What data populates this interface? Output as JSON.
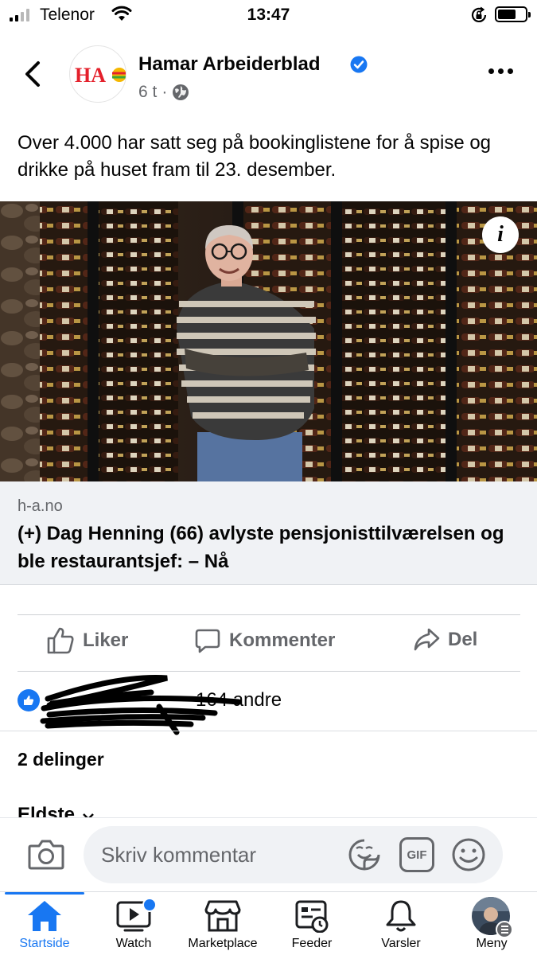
{
  "status_bar": {
    "carrier": "Telenor",
    "time": "13:47"
  },
  "post": {
    "page_name": "Hamar Arbeiderblad",
    "logo_text": "HA",
    "time_ago": "6 t",
    "separator": "·",
    "text": "Over 4.000 har satt seg på bookinglistene for å spise og drikke på huset fram til 23. desember.",
    "info_glyph": "i"
  },
  "link": {
    "domain": "h-a.no",
    "title": "(+) Dag Henning (66) avlyste pensjonisttilværelsen og ble restaurantsjef: – Nå"
  },
  "actions": {
    "like": "Liker",
    "comment": "Kommenter",
    "share": "Del"
  },
  "reactions": {
    "visible_text": "164 andre"
  },
  "shares": "2 delinger",
  "comments": {
    "sort_label": "Eldste",
    "placeholder": "Skriv kommentar",
    "gif_label": "GIF"
  },
  "tabs": [
    {
      "label": "Startside",
      "active": true
    },
    {
      "label": "Watch"
    },
    {
      "label": "Marketplace"
    },
    {
      "label": "Feeder"
    },
    {
      "label": "Varsler"
    },
    {
      "label": "Meny"
    }
  ],
  "colors": {
    "accent": "#1877f2",
    "secondary_text": "#65676b",
    "card_bg": "#f0f2f5"
  },
  "icons": [
    "back-arrow-icon",
    "verified-badge-icon",
    "globe-icon",
    "more-icon",
    "info-icon",
    "like-icon",
    "comment-icon",
    "share-icon",
    "camera-icon",
    "sticker-icon",
    "gif-icon",
    "emoji-icon",
    "home-icon",
    "watch-icon",
    "marketplace-icon",
    "feeds-icon",
    "bell-icon",
    "menu-icon"
  ]
}
